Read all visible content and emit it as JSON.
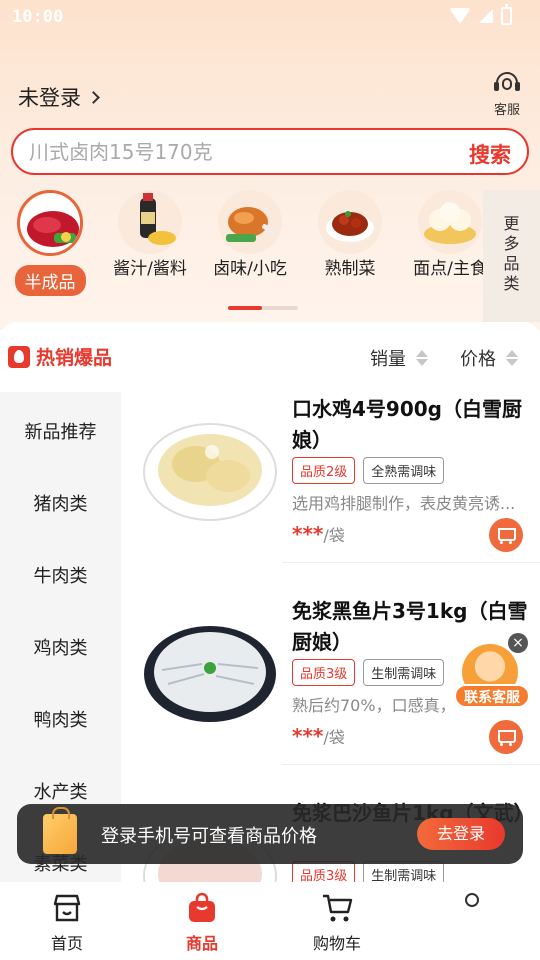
{
  "status": {
    "time": "10:00"
  },
  "header": {
    "login_label": "未登录",
    "service_label": "客服"
  },
  "search": {
    "placeholder": "川式卤肉15号170克",
    "button_label": "搜索"
  },
  "categories": [
    {
      "label": "半成品",
      "active": true
    },
    {
      "label": "酱汁/酱料"
    },
    {
      "label": "卤味/小吃"
    },
    {
      "label": "熟制菜"
    },
    {
      "label": "面点/主食"
    }
  ],
  "more_categories_label": "更多品类",
  "section": {
    "hot_label": "热销爆品",
    "sort_sales": "销量",
    "sort_price": "价格"
  },
  "sidebar": [
    "新品推荐",
    "猪肉类",
    "牛肉类",
    "鸡肉类",
    "鸭肉类",
    "水产类",
    "素菜类"
  ],
  "products": [
    {
      "title": "口水鸡4号900g（白雪厨娘）",
      "tags": [
        "品质2级",
        "全熟需调味"
      ],
      "desc": "选用鸡排腿制作，表皮黄亮诱...",
      "price_mask": "***",
      "unit": "/袋"
    },
    {
      "title": "免浆黑鱼片3号1kg（白雪厨娘）",
      "tags": [
        "品质3级",
        "生制需调味"
      ],
      "desc": "熟后约70%，口感真，",
      "price_mask": "***",
      "unit": "/袋"
    },
    {
      "title": "免浆巴沙鱼片1kg（文武）",
      "tags": [
        "品质3级",
        "生制需调味"
      ]
    }
  ],
  "float_service": {
    "label": "联系客服",
    "close": "×"
  },
  "toast": {
    "message": "登录手机号可查看商品价格",
    "button_label": "去登录"
  },
  "tabbar": [
    {
      "label": "首页"
    },
    {
      "label": "商品",
      "active": true
    },
    {
      "label": "购物车"
    }
  ],
  "colors": {
    "accent": "#e8392e",
    "accent_orange": "#ef6a3c",
    "top_bg": "#fde2cd"
  }
}
